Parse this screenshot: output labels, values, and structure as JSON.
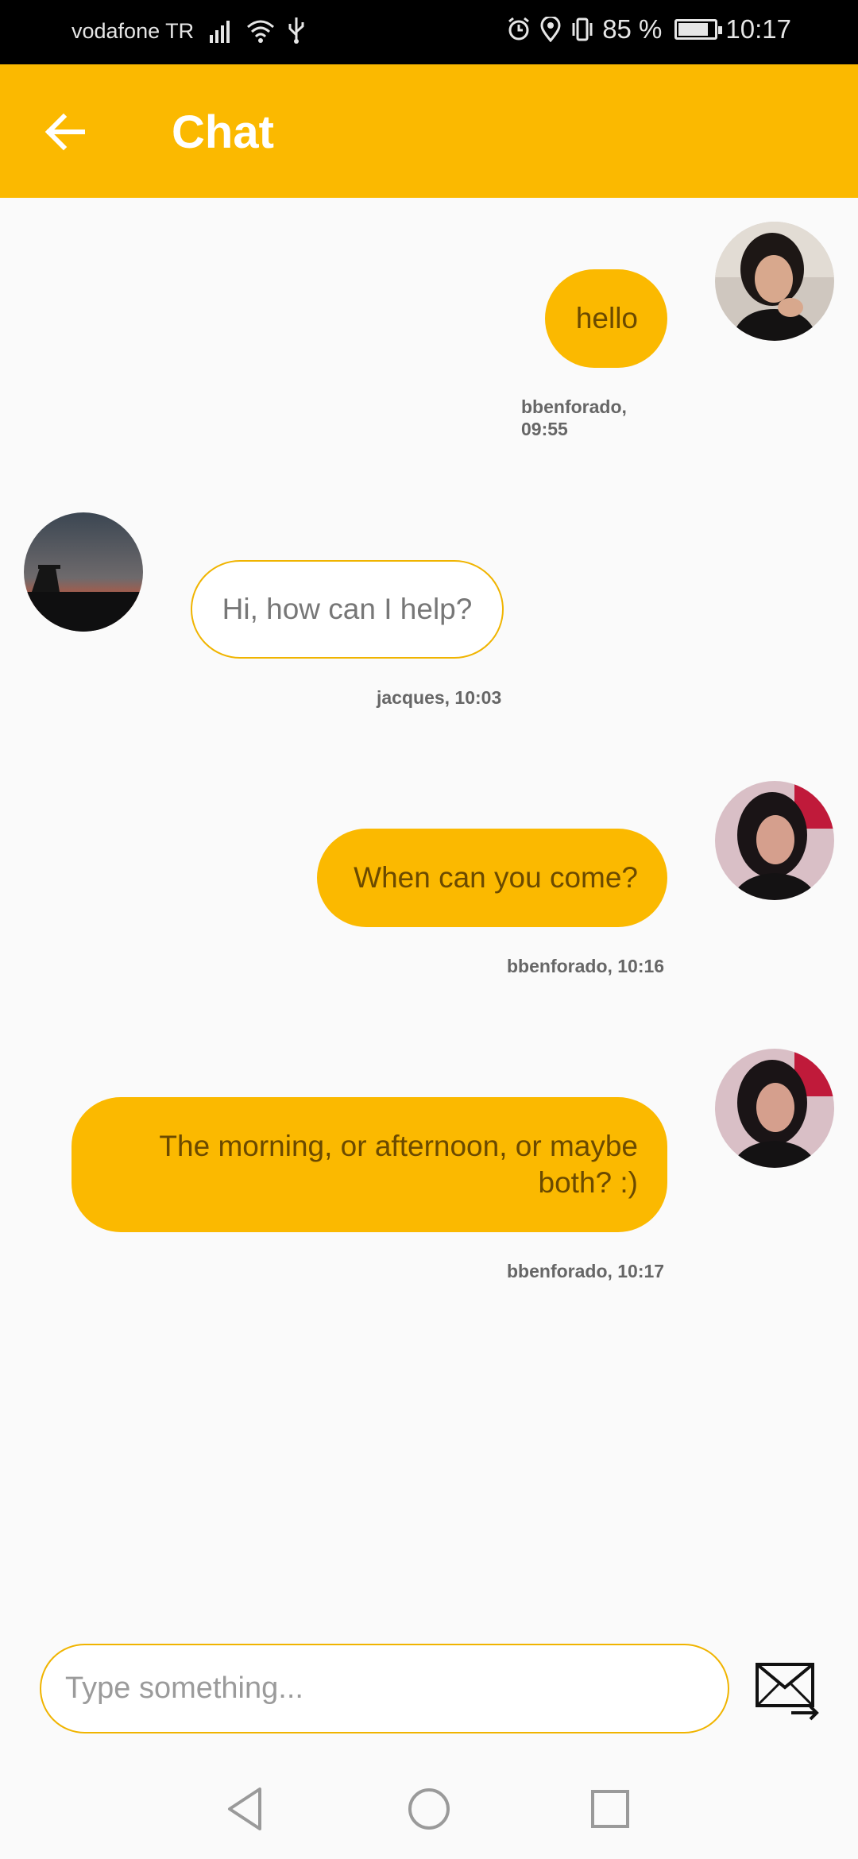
{
  "status_bar": {
    "carrier": "vodafone TR",
    "battery_text": "85 %",
    "battery_level": 0.85,
    "time": "10:17"
  },
  "app_bar": {
    "title": "Chat",
    "back_icon": "arrow-left-icon"
  },
  "messages": [
    {
      "direction": "outgoing",
      "text": "hello",
      "sender_time": "bbenforado, 09:55"
    },
    {
      "direction": "incoming",
      "text": "Hi, how can I help?",
      "sender_time": "jacques, 10:03"
    },
    {
      "direction": "outgoing",
      "text": "When can you come?",
      "sender_time": "bbenforado, 10:16"
    },
    {
      "direction": "outgoing",
      "text": "The morning, or afternoon, or maybe both? :)",
      "sender_time": "bbenforado, 10:17"
    }
  ],
  "composer": {
    "placeholder": "Type something...",
    "value": "",
    "send_icon": "envelope-send-icon"
  },
  "nav_bar": {
    "back_icon": "triangle-back-icon",
    "home_icon": "circle-home-icon",
    "recents_icon": "square-recents-icon"
  },
  "colors": {
    "accent": "#fbb900",
    "background": "#fafafa",
    "outgoing_text": "#6b4a00",
    "incoming_text": "#777777"
  }
}
